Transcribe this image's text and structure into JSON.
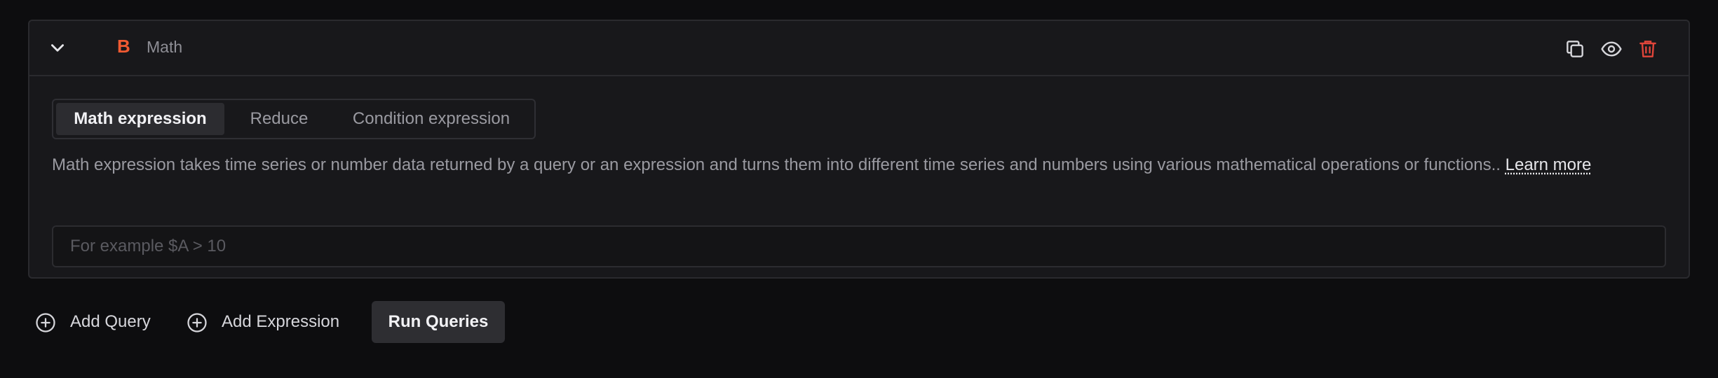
{
  "query": {
    "letter": "B",
    "type_label": "Math",
    "icons": [
      "chevron-down-icon",
      "copy-icon",
      "eye-icon",
      "trash-icon"
    ],
    "accent_color": "#f05a32",
    "delete_color": "#e0453a"
  },
  "tabs": [
    {
      "label": "Math expression",
      "active": true
    },
    {
      "label": "Reduce",
      "active": false
    },
    {
      "label": "Condition expression",
      "active": false
    }
  ],
  "description": {
    "text": "Math expression takes time series or number data returned by a query or an expression and turns them into different time series and numbers using various mathematical operations or functions.. ",
    "link": "Learn more"
  },
  "expression_input": {
    "value": "",
    "placeholder": "For example $A > 10"
  },
  "actions": {
    "add_query": "Add Query",
    "add_expression": "Add Expression",
    "run_queries": "Run Queries"
  }
}
